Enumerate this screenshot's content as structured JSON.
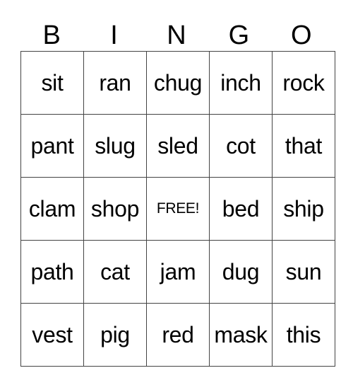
{
  "header": [
    "B",
    "I",
    "N",
    "G",
    "O"
  ],
  "rows": [
    [
      "sit",
      "ran",
      "chug",
      "inch",
      "rock"
    ],
    [
      "pant",
      "slug",
      "sled",
      "cot",
      "that"
    ],
    [
      "clam",
      "shop",
      "FREE!",
      "bed",
      "ship"
    ],
    [
      "path",
      "cat",
      "jam",
      "dug",
      "sun"
    ],
    [
      "vest",
      "pig",
      "red",
      "mask",
      "this"
    ]
  ]
}
